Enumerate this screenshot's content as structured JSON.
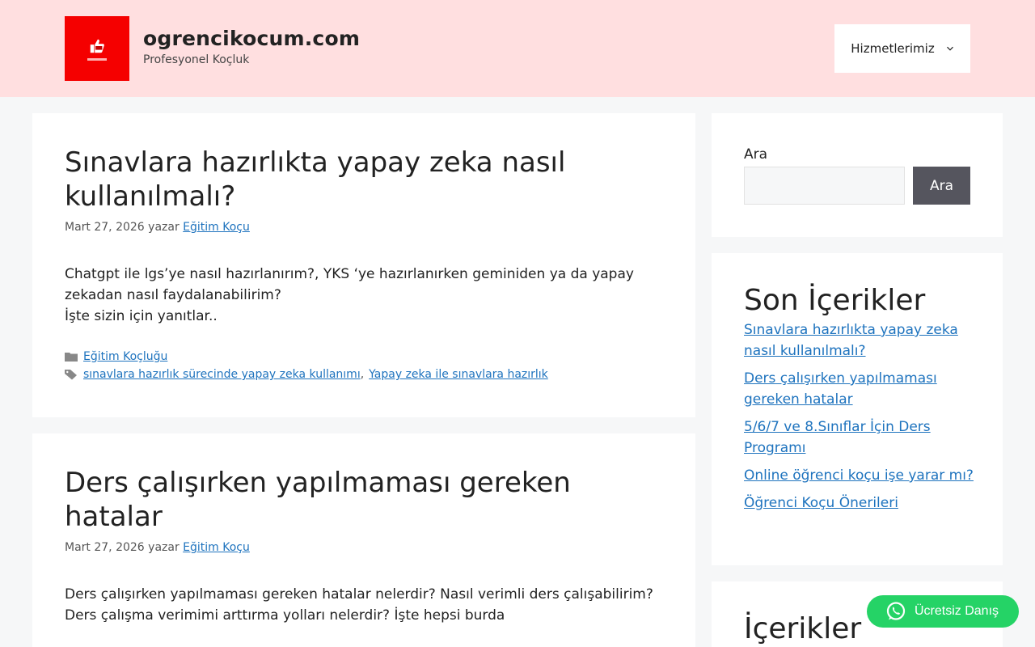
{
  "header": {
    "site_title": "ogrencikocum.com",
    "tagline": "Profesyonel Koçluk",
    "nav_label": "Hizmetlerimiz",
    "brand_color": "#f50000",
    "header_bg": "#ffdfe0"
  },
  "posts": [
    {
      "title": "Sınavlara hazırlıkta yapay zeka nasıl kullanılmalı?",
      "date": "Mart 27, 2026",
      "by": "yazar",
      "author": "Eğitim Koçu",
      "summary_line1": "Chatgpt ile lgs’ye nasıl hazırlanırım?, YKS ‘ye hazırlanırken geminiden ya da yapay zekadan nasıl faydalanabilirim?",
      "summary_line2": "İşte sizin için yanıtlar..",
      "category": "Eğitim Koçluğu",
      "tags": [
        "sınavlara hazırlık sürecinde yapay zeka kullanımı",
        "Yapay zeka ile sınavlara hazırlık"
      ],
      "tag_separator": ","
    },
    {
      "title": "Ders çalışırken yapılmaması gereken hatalar",
      "date": "Mart 27, 2026",
      "by": "yazar",
      "author": "Eğitim Koçu",
      "summary_line1": "Ders çalışırken yapılmaması gereken hatalar nelerdir? Nasıl verimli ders çalışabilirim? Ders çalışma verimimi arttırma yolları nelerdir? İşte hepsi burda"
    }
  ],
  "sidebar": {
    "search_label": "Ara",
    "search_value": "",
    "search_button": "Ara",
    "recent_title": "Son İçerikler",
    "recent_items": [
      "Sınavlara hazırlıkta yapay zeka nasıl kullanılmalı?",
      "Ders çalışırken yapılmaması gereken hatalar",
      "5/6/7 ve 8.Sınıflar İçin Ders Programı",
      "Online öğrenci koçu işe yarar mı?",
      "Öğrenci Koçu Önerileri"
    ],
    "categories_title": "İçerikler"
  },
  "fab": {
    "label": "Ücretsiz Danış",
    "color": "#25d366",
    "icon": "whatsapp-icon"
  },
  "icons": {
    "category": "folder-icon",
    "tags": "tag-icon",
    "nav": "chevron-down-icon"
  }
}
